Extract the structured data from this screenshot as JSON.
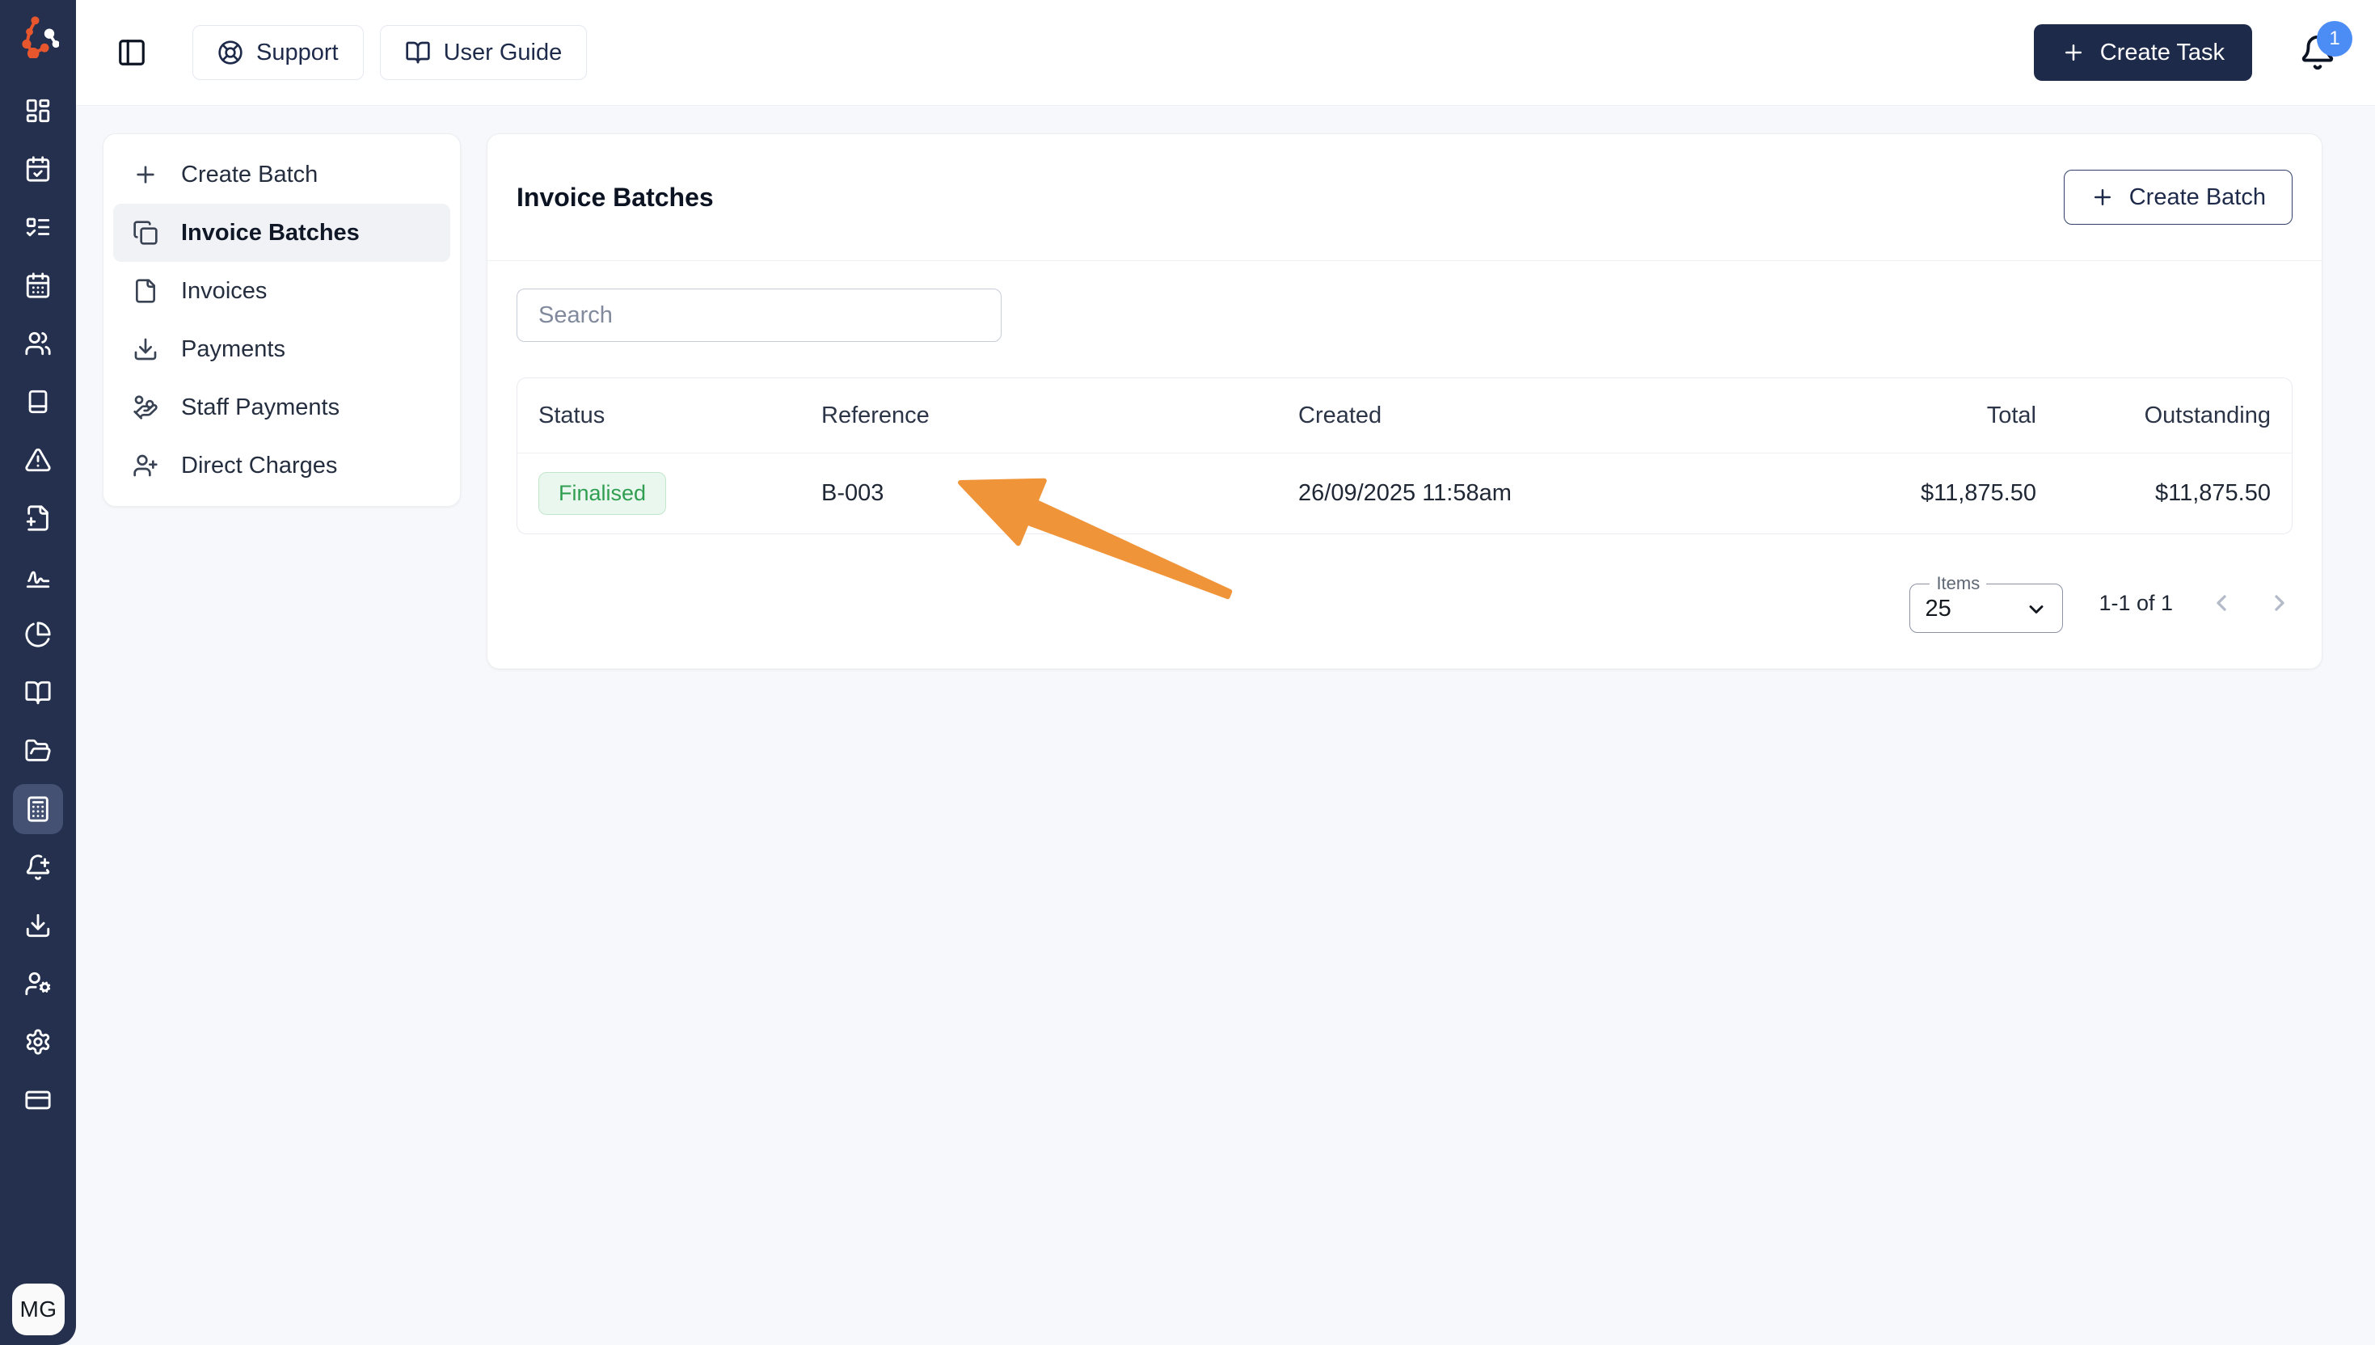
{
  "sidebar": {
    "avatar_initials": "MG",
    "active_icon": "calculator",
    "icons": [
      "dashboard",
      "calendar-check",
      "task-list",
      "calendar-days",
      "users",
      "notebook",
      "alert-triangle",
      "file-plus",
      "signature",
      "pie-chart",
      "book-open",
      "folder-open",
      "calculator",
      "bell-plus",
      "download",
      "user-settings",
      "settings",
      "credit-card"
    ]
  },
  "topbar": {
    "support_label": "Support",
    "user_guide_label": "User Guide",
    "create_task_label": "Create Task",
    "notification_count": "1"
  },
  "menu": {
    "items": [
      {
        "label": "Create Batch",
        "icon": "plus"
      },
      {
        "label": "Invoice Batches",
        "icon": "copy",
        "active": true
      },
      {
        "label": "Invoices",
        "icon": "file"
      },
      {
        "label": "Payments",
        "icon": "download"
      },
      {
        "label": "Staff Payments",
        "icon": "hand-coins"
      },
      {
        "label": "Direct Charges",
        "icon": "user-plus"
      }
    ]
  },
  "main": {
    "title": "Invoice Batches",
    "create_batch_label": "Create Batch",
    "search_placeholder": "Search",
    "table": {
      "columns": [
        "Status",
        "Reference",
        "Created",
        "Total",
        "Outstanding"
      ],
      "rows": [
        {
          "status": "Finalised",
          "reference": "B-003",
          "created": "26/09/2025 11:58am",
          "total": "$11,875.50",
          "outstanding": "$11,875.50"
        }
      ]
    },
    "pagination": {
      "items_label": "Items",
      "items_value": "25",
      "range_text": "1-1 of 1"
    }
  },
  "colors": {
    "sidebar_bg": "#24304e",
    "accent_navy": "#1e2a4a",
    "status_green_text": "#2f9e51",
    "status_green_bg": "#eaf7ee",
    "notification_blue": "#4c8df5",
    "logo_orange": "#e8562e"
  },
  "annotation_arrow": {
    "color": "#f0943a"
  }
}
